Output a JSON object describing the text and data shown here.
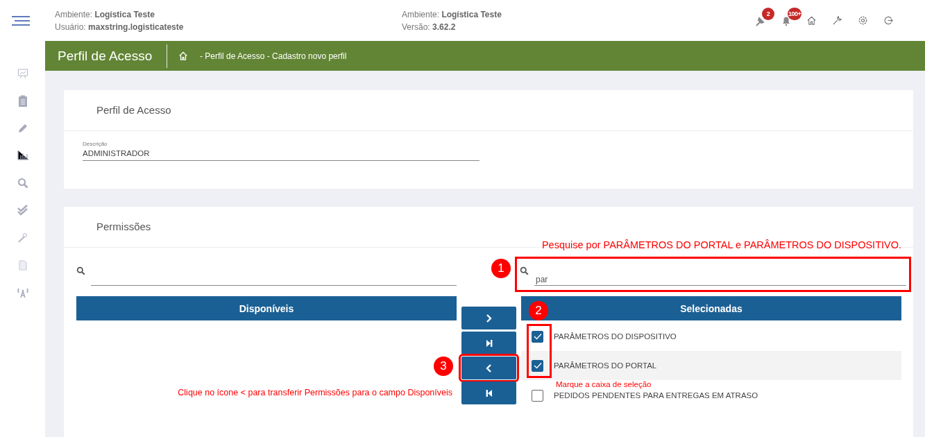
{
  "header": {
    "info_left": [
      {
        "label": "Ambiente:",
        "value": "Logística Teste"
      },
      {
        "label": "Usuário:",
        "value": "maxstring.logisticateste"
      }
    ],
    "info_right": [
      {
        "label": "Ambiente:",
        "value": "Logística Teste"
      },
      {
        "label": "Versão:",
        "value": "3.62.2"
      }
    ],
    "toolbar": [
      {
        "kind": "pin",
        "badge": "2"
      },
      {
        "kind": "bell",
        "badge": "100+"
      },
      {
        "kind": "home"
      },
      {
        "kind": "wrench"
      },
      {
        "kind": "gear"
      },
      {
        "kind": "logout"
      }
    ]
  },
  "sidebar": {
    "items": [
      {
        "kind": "presentation"
      },
      {
        "kind": "clipboard"
      },
      {
        "kind": "pencil"
      },
      {
        "kind": "chart"
      },
      {
        "kind": "search"
      },
      {
        "kind": "double-check"
      },
      {
        "kind": "wand"
      },
      {
        "kind": "document"
      },
      {
        "kind": "antenna"
      }
    ]
  },
  "title_bar": {
    "title": "Perfil de Acesso",
    "breadcrumb": "- Perfil de Acesso - Cadastro novo perfil"
  },
  "profile_card": {
    "title": "Perfil de Acesso",
    "field": {
      "label": "Descrição",
      "value": "ADMINISTRADOR"
    }
  },
  "permissions_card": {
    "title": "Permissões",
    "available": {
      "header": "Disponíveis"
    },
    "selected": {
      "search": {
        "value": "par",
        "highlighted": true
      },
      "header": "Selecionadas",
      "items": [
        {
          "label": "PARÂMETROS DO DISPOSITIVO",
          "checked": true,
          "hovered": false
        },
        {
          "label": "PARÂMETROS DO PORTAL",
          "checked": true,
          "hovered": true
        },
        {
          "label": "PEDIDOS PENDENTES PARA ENTREGAS EM ATRASO",
          "checked": false,
          "hovered": false
        }
      ]
    },
    "transfer_buttons": [
      {
        "kind": "move-right",
        "highlighted": false
      },
      {
        "kind": "move-all-right",
        "highlighted": false
      },
      {
        "kind": "move-left",
        "highlighted": true
      },
      {
        "kind": "move-all-left",
        "highlighted": false
      }
    ]
  },
  "annotations": {
    "search_note": "Pesquise por PARÂMETROS DO PORTAL e PARÂMETROS DO DISPOSITIVO.",
    "markers": [
      "1",
      "2",
      "3"
    ],
    "checkbox_note": "Marque a caixa de seleção",
    "transfer_note": "Clique no ícone < para transferir Permissões para o campo Disponíveis"
  }
}
